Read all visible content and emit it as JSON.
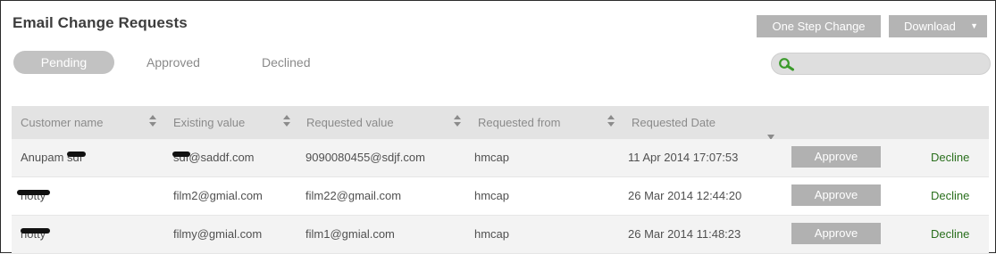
{
  "header": {
    "title": "Email Change Requests",
    "one_step_label": "One Step Change",
    "download_label": "Download",
    "download_caret": "▼"
  },
  "tabs": [
    {
      "label": "Pending",
      "active": true
    },
    {
      "label": "Approved",
      "active": false
    },
    {
      "label": "Declined",
      "active": false
    }
  ],
  "search": {
    "value": "",
    "placeholder": ""
  },
  "table": {
    "columns": [
      "Customer name",
      "Existing value",
      "Requested value",
      "Requested from",
      "Requested Date"
    ],
    "rows": [
      {
        "customer": "Anupam sdf",
        "existing": "sdf@saddf.com",
        "requested": "9090080455@sdjf.com",
        "from": "hmcap",
        "date": "11 Apr 2014 17:07:53",
        "approve_label": "Approve",
        "decline_label": "Decline"
      },
      {
        "customer": "hotty",
        "existing": "film2@gmial.com",
        "requested": "film22@gmail.com",
        "from": "hmcap",
        "date": "26 Mar 2014 12:44:20",
        "approve_label": "Approve",
        "decline_label": "Decline"
      },
      {
        "customer": "hotty",
        "existing": "filmy@gmial.com",
        "requested": "film1@gmial.com",
        "from": "hmcap",
        "date": "26 Mar 2014 11:48:23",
        "approve_label": "Approve",
        "decline_label": "Decline"
      }
    ]
  },
  "colors": {
    "accent_green": "#2a6f1d",
    "button_gray": "#b4b4b4",
    "header_gray": "#e3e3e3"
  }
}
